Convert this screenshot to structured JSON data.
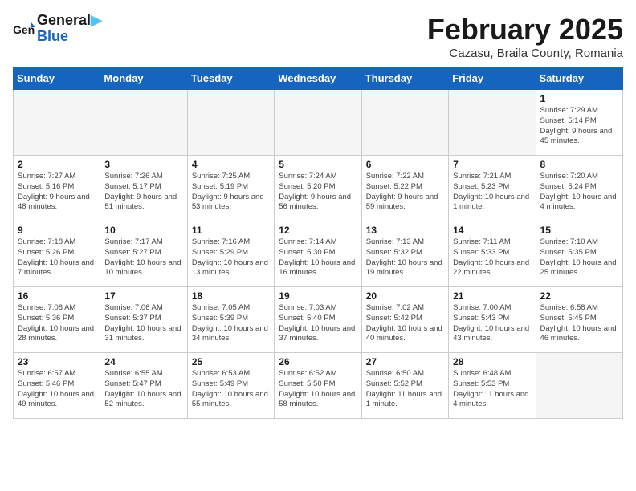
{
  "header": {
    "logo_line1": "General",
    "logo_line2": "Blue",
    "main_title": "February 2025",
    "subtitle": "Cazasu, Braila County, Romania"
  },
  "weekdays": [
    "Sunday",
    "Monday",
    "Tuesday",
    "Wednesday",
    "Thursday",
    "Friday",
    "Saturday"
  ],
  "weeks": [
    [
      {
        "day": "",
        "info": ""
      },
      {
        "day": "",
        "info": ""
      },
      {
        "day": "",
        "info": ""
      },
      {
        "day": "",
        "info": ""
      },
      {
        "day": "",
        "info": ""
      },
      {
        "day": "",
        "info": ""
      },
      {
        "day": "1",
        "info": "Sunrise: 7:29 AM\nSunset: 5:14 PM\nDaylight: 9 hours\nand 45 minutes."
      }
    ],
    [
      {
        "day": "2",
        "info": "Sunrise: 7:27 AM\nSunset: 5:16 PM\nDaylight: 9 hours\nand 48 minutes."
      },
      {
        "day": "3",
        "info": "Sunrise: 7:26 AM\nSunset: 5:17 PM\nDaylight: 9 hours\nand 51 minutes."
      },
      {
        "day": "4",
        "info": "Sunrise: 7:25 AM\nSunset: 5:19 PM\nDaylight: 9 hours\nand 53 minutes."
      },
      {
        "day": "5",
        "info": "Sunrise: 7:24 AM\nSunset: 5:20 PM\nDaylight: 9 hours\nand 56 minutes."
      },
      {
        "day": "6",
        "info": "Sunrise: 7:22 AM\nSunset: 5:22 PM\nDaylight: 9 hours\nand 59 minutes."
      },
      {
        "day": "7",
        "info": "Sunrise: 7:21 AM\nSunset: 5:23 PM\nDaylight: 10 hours\nand 1 minute."
      },
      {
        "day": "8",
        "info": "Sunrise: 7:20 AM\nSunset: 5:24 PM\nDaylight: 10 hours\nand 4 minutes."
      }
    ],
    [
      {
        "day": "9",
        "info": "Sunrise: 7:18 AM\nSunset: 5:26 PM\nDaylight: 10 hours\nand 7 minutes."
      },
      {
        "day": "10",
        "info": "Sunrise: 7:17 AM\nSunset: 5:27 PM\nDaylight: 10 hours\nand 10 minutes."
      },
      {
        "day": "11",
        "info": "Sunrise: 7:16 AM\nSunset: 5:29 PM\nDaylight: 10 hours\nand 13 minutes."
      },
      {
        "day": "12",
        "info": "Sunrise: 7:14 AM\nSunset: 5:30 PM\nDaylight: 10 hours\nand 16 minutes."
      },
      {
        "day": "13",
        "info": "Sunrise: 7:13 AM\nSunset: 5:32 PM\nDaylight: 10 hours\nand 19 minutes."
      },
      {
        "day": "14",
        "info": "Sunrise: 7:11 AM\nSunset: 5:33 PM\nDaylight: 10 hours\nand 22 minutes."
      },
      {
        "day": "15",
        "info": "Sunrise: 7:10 AM\nSunset: 5:35 PM\nDaylight: 10 hours\nand 25 minutes."
      }
    ],
    [
      {
        "day": "16",
        "info": "Sunrise: 7:08 AM\nSunset: 5:36 PM\nDaylight: 10 hours\nand 28 minutes."
      },
      {
        "day": "17",
        "info": "Sunrise: 7:06 AM\nSunset: 5:37 PM\nDaylight: 10 hours\nand 31 minutes."
      },
      {
        "day": "18",
        "info": "Sunrise: 7:05 AM\nSunset: 5:39 PM\nDaylight: 10 hours\nand 34 minutes."
      },
      {
        "day": "19",
        "info": "Sunrise: 7:03 AM\nSunset: 5:40 PM\nDaylight: 10 hours\nand 37 minutes."
      },
      {
        "day": "20",
        "info": "Sunrise: 7:02 AM\nSunset: 5:42 PM\nDaylight: 10 hours\nand 40 minutes."
      },
      {
        "day": "21",
        "info": "Sunrise: 7:00 AM\nSunset: 5:43 PM\nDaylight: 10 hours\nand 43 minutes."
      },
      {
        "day": "22",
        "info": "Sunrise: 6:58 AM\nSunset: 5:45 PM\nDaylight: 10 hours\nand 46 minutes."
      }
    ],
    [
      {
        "day": "23",
        "info": "Sunrise: 6:57 AM\nSunset: 5:46 PM\nDaylight: 10 hours\nand 49 minutes."
      },
      {
        "day": "24",
        "info": "Sunrise: 6:55 AM\nSunset: 5:47 PM\nDaylight: 10 hours\nand 52 minutes."
      },
      {
        "day": "25",
        "info": "Sunrise: 6:53 AM\nSunset: 5:49 PM\nDaylight: 10 hours\nand 55 minutes."
      },
      {
        "day": "26",
        "info": "Sunrise: 6:52 AM\nSunset: 5:50 PM\nDaylight: 10 hours\nand 58 minutes."
      },
      {
        "day": "27",
        "info": "Sunrise: 6:50 AM\nSunset: 5:52 PM\nDaylight: 11 hours\nand 1 minute."
      },
      {
        "day": "28",
        "info": "Sunrise: 6:48 AM\nSunset: 5:53 PM\nDaylight: 11 hours\nand 4 minutes."
      },
      {
        "day": "",
        "info": ""
      }
    ]
  ]
}
